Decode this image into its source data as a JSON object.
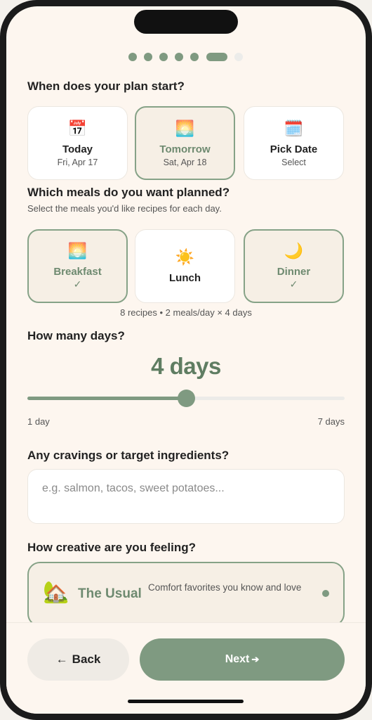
{
  "progress": {
    "total_steps": 7,
    "current_step": 6
  },
  "start": {
    "question": "When does your plan start?",
    "options": [
      {
        "icon": "calendar-icon",
        "glyph": "📅",
        "label": "Today",
        "sub": "Fri, Apr 17",
        "selected": false
      },
      {
        "icon": "sunrise-icon",
        "glyph": "🌅",
        "label": "Tomorrow",
        "sub": "Sat, Apr 18",
        "selected": true
      },
      {
        "icon": "spiral-calendar-icon",
        "glyph": "🗓️",
        "label": "Pick Date",
        "sub": "Select",
        "selected": false
      }
    ]
  },
  "meals": {
    "question": "Which meals do you want planned?",
    "subtitle": "Select the meals you'd like recipes for each day.",
    "options": [
      {
        "icon": "sunrise-icon",
        "glyph": "🌅",
        "label": "Breakfast",
        "selected": true,
        "check": "✓"
      },
      {
        "icon": "sun-icon",
        "glyph": "☀️",
        "label": "Lunch",
        "selected": false,
        "check": ""
      },
      {
        "icon": "moon-icon",
        "glyph": "🌙",
        "label": "Dinner",
        "selected": true,
        "check": "✓"
      }
    ],
    "summary": "8 recipes • 2 meals/day × 4 days"
  },
  "days": {
    "question": "How many days?",
    "value_label": "4 days",
    "value": 4,
    "min": 1,
    "max": 7,
    "min_label": "1 day",
    "max_label": "7 days"
  },
  "cravings": {
    "question": "Any cravings or target ingredients?",
    "placeholder": "e.g. salmon, tacos, sweet potatoes...",
    "value": ""
  },
  "creative": {
    "question": "How creative are you feeling?",
    "option": {
      "icon": "house-icon",
      "glyph": "🏡",
      "title": "The Usual",
      "description": "Comfort favorites you know and love"
    }
  },
  "footer": {
    "back_label": "Back",
    "back_arrow": "←",
    "next_label": "Next",
    "next_arrow": "➔"
  },
  "colors": {
    "accent": "#7f9a81",
    "accent_text": "#6e8a70",
    "background": "#fdf6ef",
    "selected_card": "#f6efe5"
  }
}
